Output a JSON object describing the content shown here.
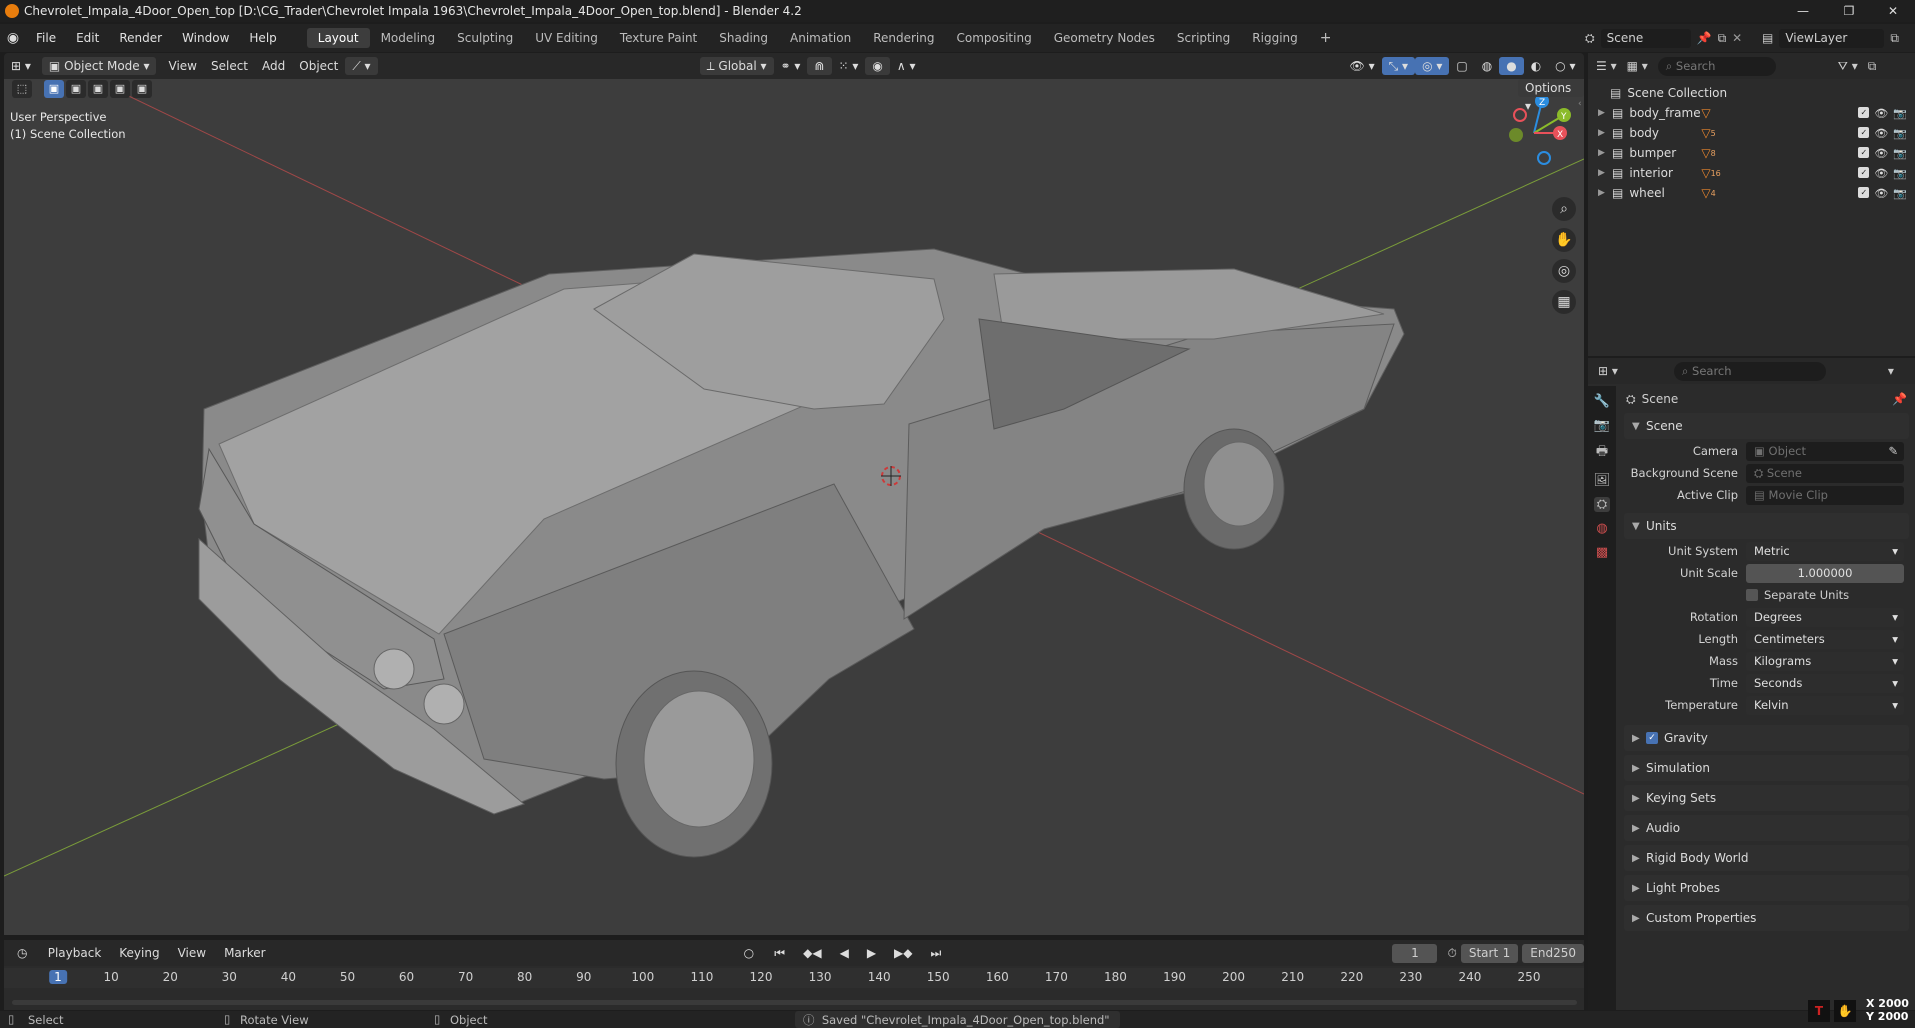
{
  "window": {
    "title": "Chevrolet_Impala_4Door_Open_top [D:\\CG_Trader\\Chevrolet Impala 1963\\Chevrolet_Impala_4Door_Open_top.blend] - Blender 4.2"
  },
  "menu": {
    "items": [
      "File",
      "Edit",
      "Render",
      "Window",
      "Help"
    ]
  },
  "workspaces": [
    "Layout",
    "Modeling",
    "Sculpting",
    "UV Editing",
    "Texture Paint",
    "Shading",
    "Animation",
    "Rendering",
    "Compositing",
    "Geometry Nodes",
    "Scripting",
    "Rigging"
  ],
  "scene_selector": {
    "scene": "Scene",
    "view_layer": "ViewLayer"
  },
  "viewport_header": {
    "mode": "Object Mode",
    "menus": [
      "View",
      "Select",
      "Add",
      "Object"
    ],
    "transform": "Global",
    "options": "Options"
  },
  "viewport": {
    "line1": "User Perspective",
    "line2": "(1) Scene Collection",
    "gizmo": {
      "x": "X",
      "y": "Y",
      "z": "Z"
    }
  },
  "outliner": {
    "search_placeholder": "Search",
    "root": "Scene Collection",
    "items": [
      {
        "name": "body_frame",
        "sub": ""
      },
      {
        "name": "body",
        "sub": "5"
      },
      {
        "name": "bumper",
        "sub": "8"
      },
      {
        "name": "interior",
        "sub": "16"
      },
      {
        "name": "wheel",
        "sub": "4"
      }
    ]
  },
  "properties": {
    "search_placeholder": "Search",
    "context": "Scene",
    "scene_panel": "Scene",
    "camera_label": "Camera",
    "camera_placeholder": "Object",
    "bg_label": "Background Scene",
    "bg_placeholder": "Scene",
    "clip_label": "Active Clip",
    "clip_placeholder": "Movie Clip",
    "units_panel": "Units",
    "unit_system_label": "Unit System",
    "unit_system": "Metric",
    "unit_scale_label": "Unit Scale",
    "unit_scale": "1.000000",
    "separate_units": "Separate Units",
    "rotation_label": "Rotation",
    "rotation": "Degrees",
    "length_label": "Length",
    "length": "Centimeters",
    "mass_label": "Mass",
    "mass": "Kilograms",
    "time_label": "Time",
    "time": "Seconds",
    "temperature_label": "Temperature",
    "temperature": "Kelvin",
    "gravity": "Gravity",
    "collapsed": [
      "Simulation",
      "Keying Sets",
      "Audio",
      "Rigid Body World",
      "Light Probes",
      "Custom Properties"
    ]
  },
  "timeline": {
    "menus": [
      "Playback",
      "Keying",
      "View",
      "Marker"
    ],
    "current_frame": "1",
    "start_label": "Start",
    "start": "1",
    "end_label": "End",
    "end": "250",
    "ticks": [
      "1",
      "10",
      "20",
      "30",
      "40",
      "50",
      "60",
      "70",
      "80",
      "90",
      "100",
      "110",
      "120",
      "130",
      "140",
      "150",
      "160",
      "170",
      "180",
      "190",
      "200",
      "210",
      "220",
      "230",
      "240",
      "250"
    ]
  },
  "statusbar": {
    "select": "Select",
    "rotate": "Rotate View",
    "object": "Object",
    "message": "Saved \"Chevrolet_Impala_4Door_Open_top.blend\"",
    "x": "X 2000",
    "y": "Y 2000"
  },
  "colors": {
    "accent": "#4772b3",
    "x_axis": "#e8515a",
    "y_axis": "#8bbb2a",
    "z_axis": "#2b8de0",
    "cursor": "#cc3a3a"
  }
}
